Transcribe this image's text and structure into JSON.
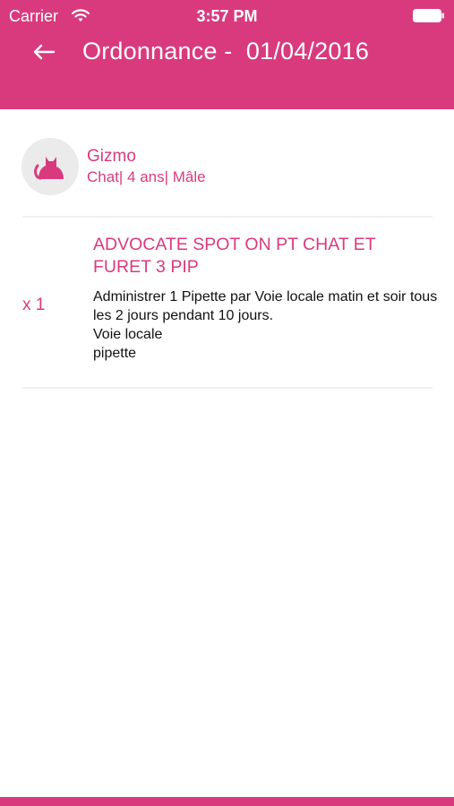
{
  "colors": {
    "accent": "#d93a7e",
    "background": "#ffffff",
    "avatar_background": "#ebebeb",
    "divider": "#f1f1f1",
    "body_text": "#111111"
  },
  "status_bar": {
    "carrier": "Carrier",
    "time": "3:57 PM",
    "icons": [
      "wifi-icon",
      "battery-icon"
    ]
  },
  "nav": {
    "back_icon": "back-arrow-icon",
    "title": "Ordonnance -  01/04/2016"
  },
  "patient": {
    "avatar_icon": "cat-icon",
    "name": "Gizmo",
    "details": "Chat| 4 ans| Mâle"
  },
  "prescription": {
    "items": [
      {
        "quantity": "x 1",
        "name": "ADVOCATE SPOT ON PT CHAT ET\nFURET  3 PIP",
        "lines": [
          "Administrer 1 Pipette par Voie locale matin et soir tous les 2 jours pendant 10 jours.",
          "Voie locale",
          "pipette"
        ]
      }
    ]
  }
}
